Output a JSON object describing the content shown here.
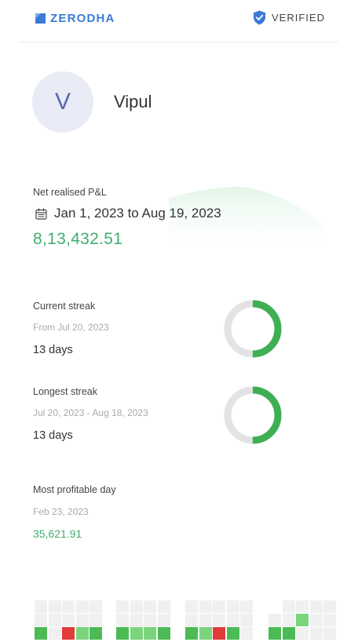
{
  "header": {
    "brand": "ZERODHA",
    "brand_color": "#3a7bd5",
    "badge_icon": "shield-check-icon",
    "badge_label": "VERIFIED"
  },
  "profile": {
    "avatar_initial": "V",
    "name": "Vipul"
  },
  "pnl": {
    "label": "Net realised P&L",
    "calendar_icon": "calendar-icon",
    "date_range": "Jan 1, 2023 to Aug 19, 2023",
    "value": "8,13,432.51",
    "value_color": "#3fae6e"
  },
  "current_streak": {
    "label": "Current streak",
    "since": "From Jul 20, 2023",
    "value": "13 days",
    "progress": 0.5
  },
  "longest_streak": {
    "label": "Longest streak",
    "range": "Jul 20, 2023 - Aug 18, 2023",
    "value": "13 days",
    "progress": 0.5
  },
  "profitable_day": {
    "label": "Most profitable day",
    "date": "Feb 23, 2023",
    "value": "35,621.91"
  },
  "heatmap": {
    "colors": {
      "empty": "#f0f0f0",
      "profit_light": "#7ad47c",
      "profit": "#4cbb55",
      "loss": "#e23b3b"
    },
    "months": [
      {
        "rows": [
          [
            "empty",
            "empty",
            "empty",
            "empty",
            "empty"
          ],
          [
            "empty",
            "empty",
            "empty",
            "empty",
            "empty"
          ],
          [
            "profit",
            "empty",
            "loss",
            "profit_light",
            "profit"
          ]
        ]
      },
      {
        "rows": [
          [
            "empty",
            "empty",
            "empty",
            "empty"
          ],
          [
            "empty",
            "empty",
            "empty",
            "empty"
          ],
          [
            "profit",
            "profit_light",
            "profit_light",
            "profit"
          ]
        ]
      },
      {
        "rows": [
          [
            "empty",
            "empty",
            "empty",
            "empty",
            "empty"
          ],
          [
            "empty",
            "empty",
            "empty",
            "empty",
            "empty"
          ],
          [
            "profit",
            "profit_light",
            "loss",
            "profit",
            "empty"
          ]
        ]
      },
      {
        "rows": [
          [
            null,
            "empty",
            "empty",
            "empty",
            "empty"
          ],
          [
            "empty",
            "empty",
            "profit_light",
            "empty",
            "empty"
          ],
          [
            "profit",
            "profit",
            "empty",
            "empty",
            "empty"
          ]
        ]
      }
    ]
  }
}
